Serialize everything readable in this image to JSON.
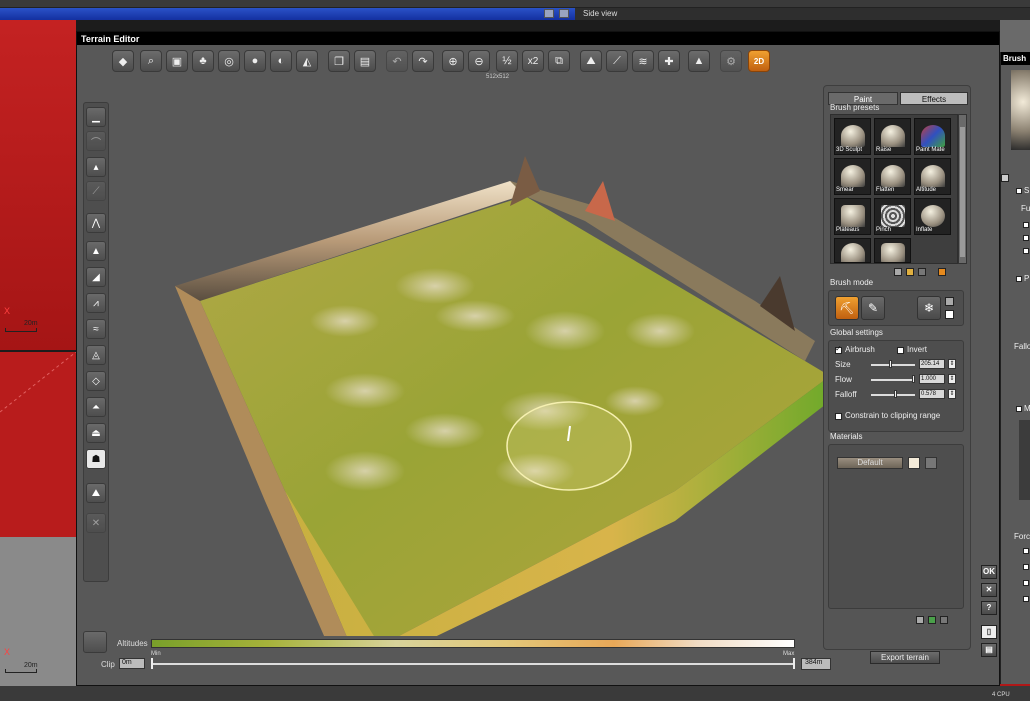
{
  "host": {
    "view_label": "Side view",
    "axis_x_label": "X",
    "scale_label": "20m",
    "status_label": "4 CPU"
  },
  "editor": {
    "title": "Terrain Editor",
    "resolution_label": "512x512",
    "toolbar": {
      "half_label": "½",
      "double_label": "x2",
      "two_d_label": "2D"
    },
    "toolbar_icons": [
      "terrain-menu-icon",
      "zoom-extents-icon",
      "render-preview-icon",
      "trees-icon",
      "globe-icon",
      "sphere-icon",
      "shaded-sphere-icon",
      "texture-icon",
      "copy-icon",
      "paste-icon",
      "undo-icon",
      "redo-icon",
      "zoom-in-icon",
      "zoom-out-icon",
      "halve-resolution-icon",
      "double-resolution-icon",
      "crop-icon",
      "altitude-icon",
      "erosion-icon",
      "fractal-icon",
      "add-icon",
      "mountain-icon",
      "settings-icon",
      "2d-brush-icon"
    ],
    "left_tools": [
      "flat-terrain-icon",
      "rounded-hill-icon",
      "peak-icon",
      "erode-icon",
      "ridge-icon",
      "mountain-icon",
      "cliff-icon",
      "canyon-icon",
      "dunes-icon",
      "rocky-icon",
      "crater-icon",
      "volcano-icon",
      "plateau-icon",
      "picture-icon",
      "random-terrain-icon",
      "disabled-tool-icon"
    ],
    "altitudes_label": "Altitudes",
    "min_label": "Min",
    "max_label": "Max",
    "clip_label": "Clip",
    "clip_min": "0m",
    "clip_max": "384m",
    "export_label": "Export terrain",
    "ok_label": "OK",
    "close_label": "✕",
    "help_label": "?"
  },
  "panel": {
    "tabs": [
      "Paint",
      "Effects"
    ],
    "brush_presets_title": "Brush presets",
    "presets": [
      "3D Sculpt",
      "Raise",
      "Paint Mate",
      "Smear",
      "Flatten",
      "Altitude",
      "Plateaus",
      "Pinch",
      "Inflate",
      "",
      ""
    ],
    "brush_mode_title": "Brush mode",
    "global_settings_title": "Global settings",
    "airbrush_label": "Airbrush",
    "invert_label": "Invert",
    "size_label": "Size",
    "size_value": "205.14",
    "flow_label": "Flow",
    "flow_value": "1.000",
    "falloff_label": "Falloff",
    "falloff_value": "0.578",
    "size_level": 0.45,
    "flow_level": 1.0,
    "falloff_level": 0.55,
    "constrain_label": "Constrain to clipping range",
    "materials_title": "Materials",
    "material_default": "Default"
  },
  "brush_window": {
    "title": "Brush",
    "labels": [
      "S",
      "Fu",
      "P",
      "Fallo",
      "M",
      "Forc"
    ]
  },
  "colors": {
    "terrain_green": "#8fa234",
    "terrain_beige": "#d9c9a6",
    "accent_orange": "#e68a1e",
    "host_red": "#b81c1c"
  }
}
